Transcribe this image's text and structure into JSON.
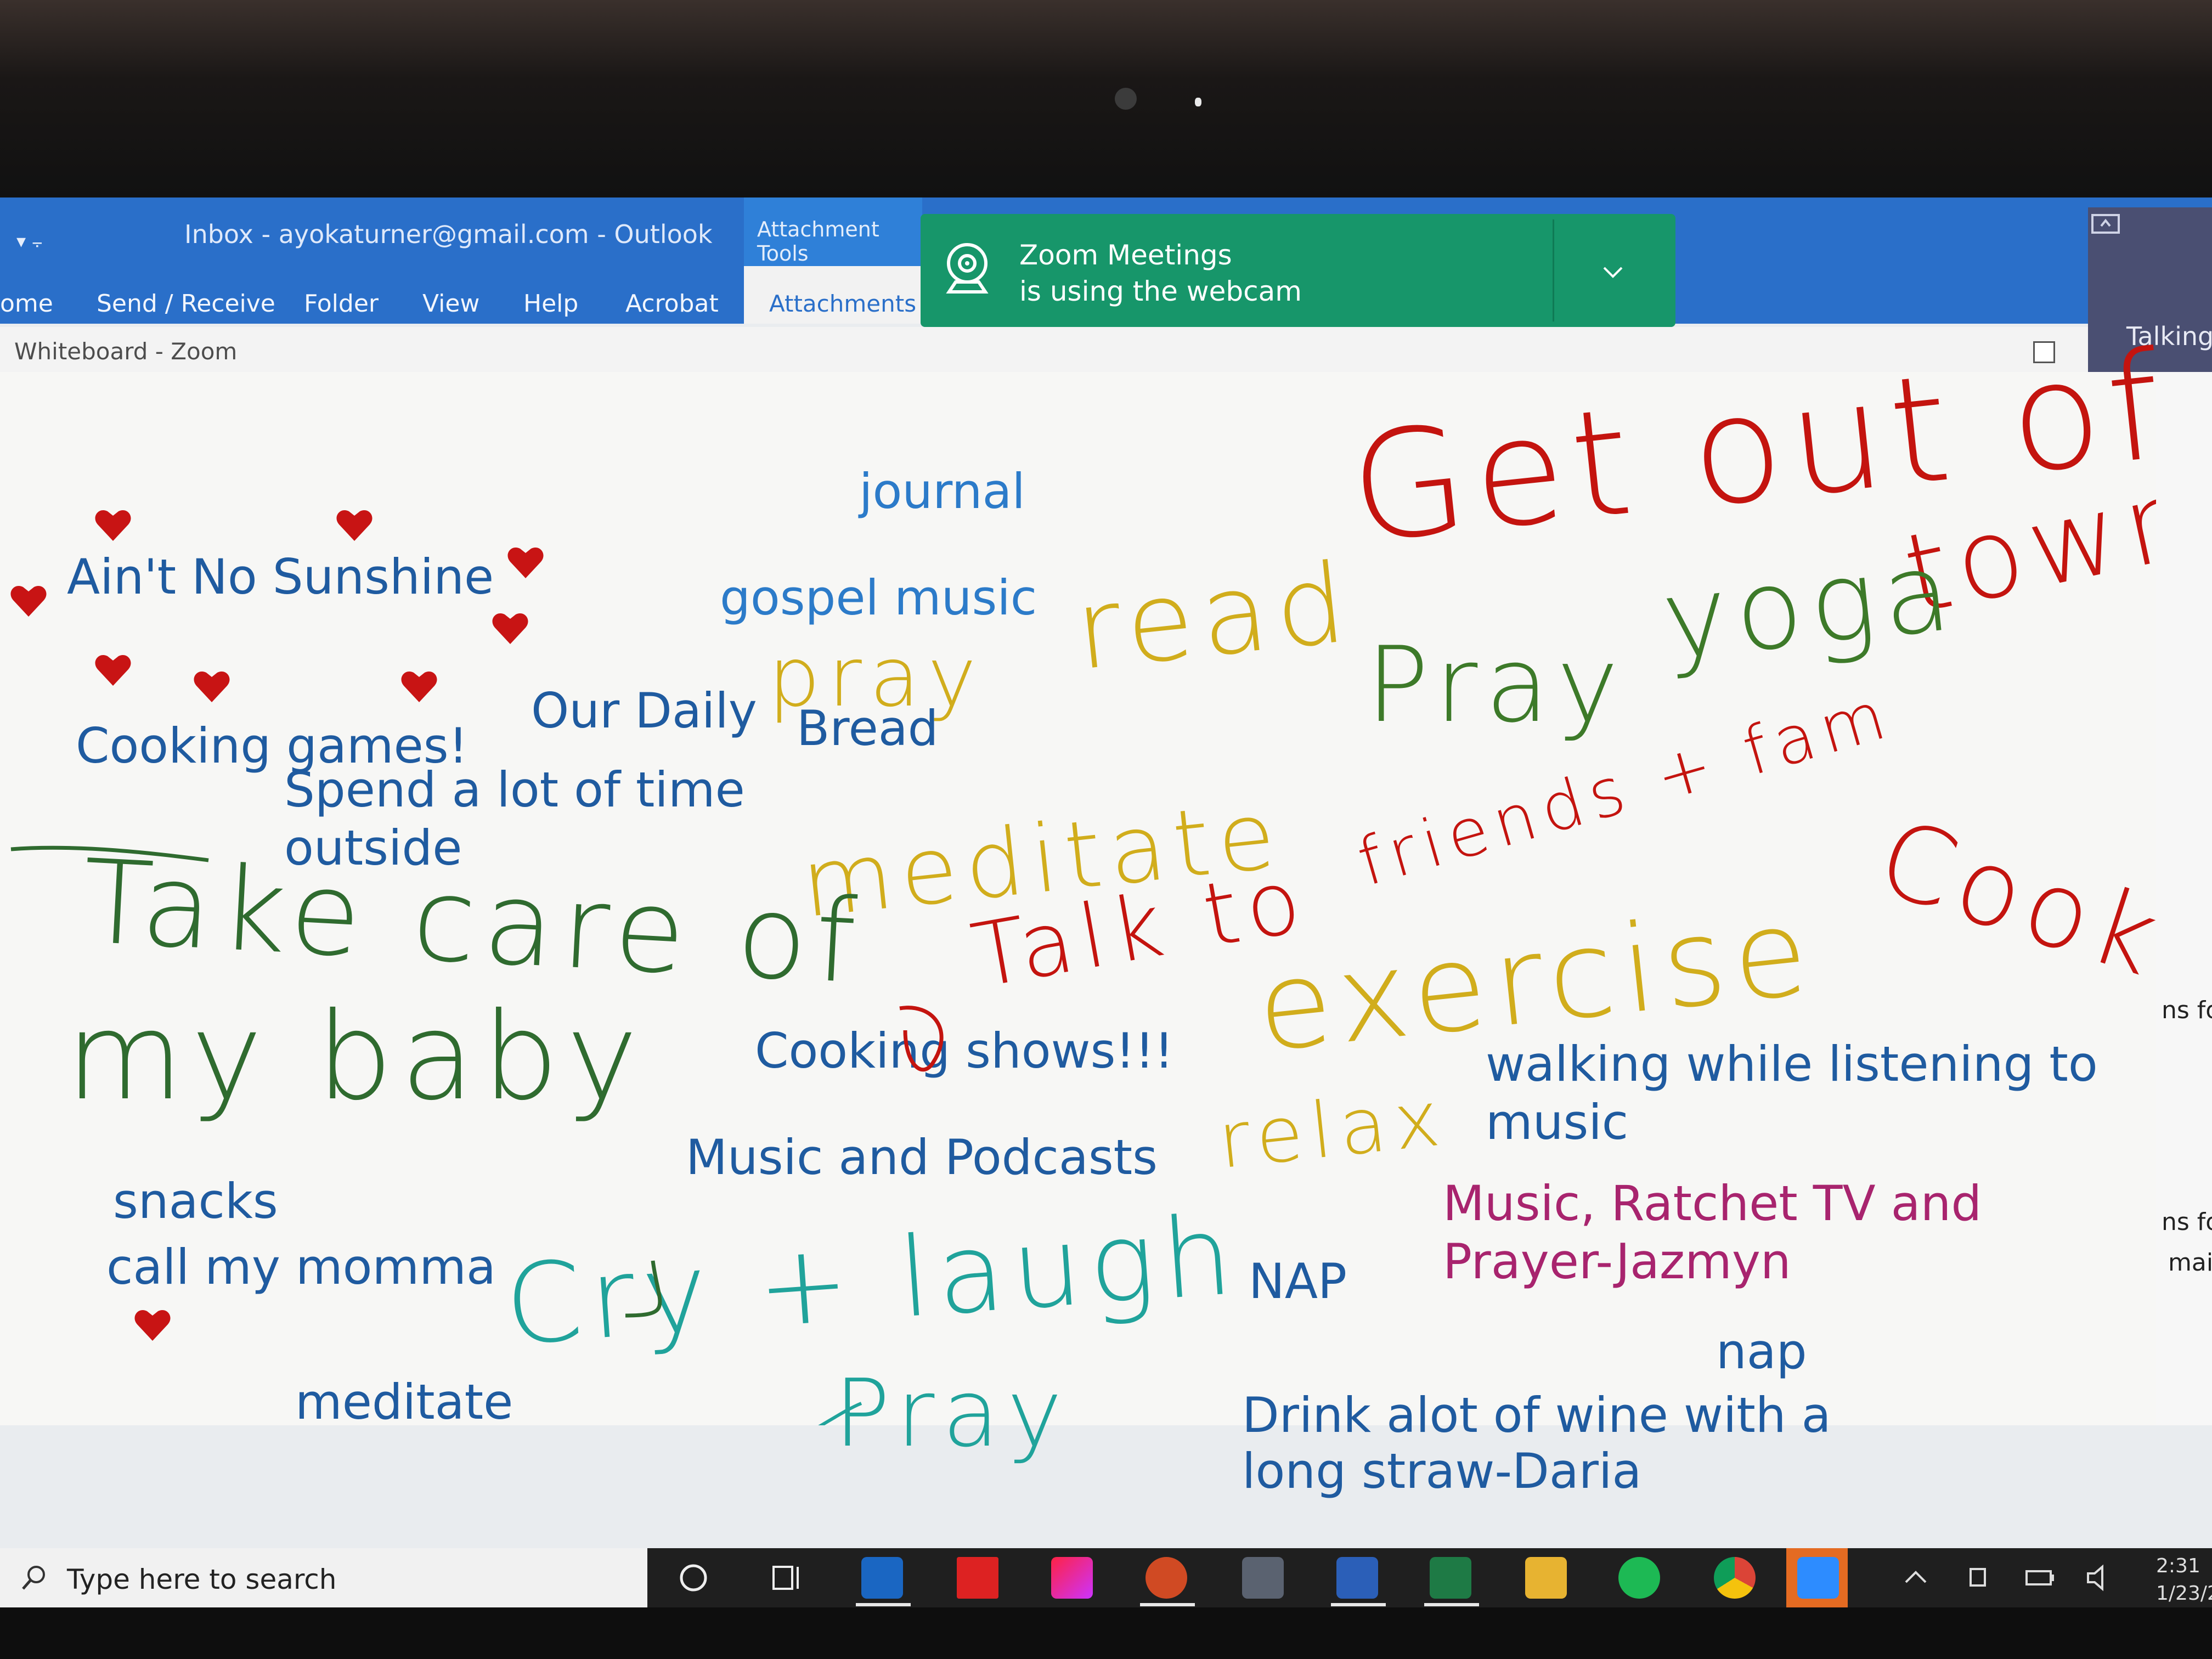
{
  "outlook": {
    "title_bar": "Inbox - ayokaturner@gmail.com  -  Outlook",
    "quick_access": "▾  ⨪",
    "contextual_group": "Attachment Tools",
    "menu": [
      "ome",
      "Send / Receive",
      "Folder",
      "View",
      "Help",
      "Acrobat"
    ],
    "active_tab": "Attachments",
    "colors": {
      "ribbon": "#2a6fc9",
      "toast": "#17966a"
    }
  },
  "zoom_toast": {
    "title": "Zoom Meetings",
    "body": "is using the webcam",
    "icon": "webcam-icon"
  },
  "talking_panel": {
    "label": "Talking"
  },
  "whiteboard": {
    "window_title": "Whiteboard - Zoom",
    "typed": {
      "aint_no_sunshine": "Ain't No Sunshine",
      "journal": "journal",
      "gospel_music": "gospel music",
      "our_daily": "Our Daily",
      "bread": "Bread",
      "cooking_games": "Cooking games!",
      "spend_time_1": "Spend a lot of time",
      "spend_time_2": "outside",
      "cooking_shows": "Cooking shows!!!",
      "music_podcasts": "Music and Podcasts",
      "walking_1": "walking while listening to",
      "walking_2": "music",
      "ratchet_1": "Music, Ratchet TV and",
      "ratchet_2": "Prayer-Jazmyn",
      "snacks": "snacks",
      "call_momma": "call my momma",
      "meditate": "meditate",
      "nap_upper": "NAP",
      "nap_lower": "nap",
      "wine_1": "Drink alot of wine with a",
      "wine_2": "long straw-Daria"
    },
    "handwritten": {
      "get_out_of": "Get out of",
      "town": "town",
      "yoga": "yoga",
      "pray_green": "Pray",
      "friends_fam": "friends + fam",
      "read": "read",
      "pray_yellow": "pray",
      "meditate": "meditate",
      "talk_to": "Talk to",
      "cook": "Cook",
      "exercise": "exercise",
      "relax": "relax",
      "take_care_of": "Take care of",
      "my_baby": "my baby",
      "cry_laugh": "Cry + laugh",
      "pray_teal": "Pray"
    },
    "right_doc_fragments": [
      "ns fo",
      "ns fo",
      "mai"
    ],
    "hearts_color": "#c81414"
  },
  "taskbar": {
    "search_placeholder": "Type here to search",
    "apps": [
      "cortana-icon",
      "task-view-icon",
      "outlook-icon",
      "acrobat-icon",
      "creative-cloud-icon",
      "powerpoint-icon",
      "calculator-icon",
      "word-icon",
      "excel-icon",
      "file-explorer-icon",
      "spotify-icon",
      "chrome-icon",
      "zoom-icon"
    ],
    "time": "2:31",
    "date": "1/23/2"
  }
}
